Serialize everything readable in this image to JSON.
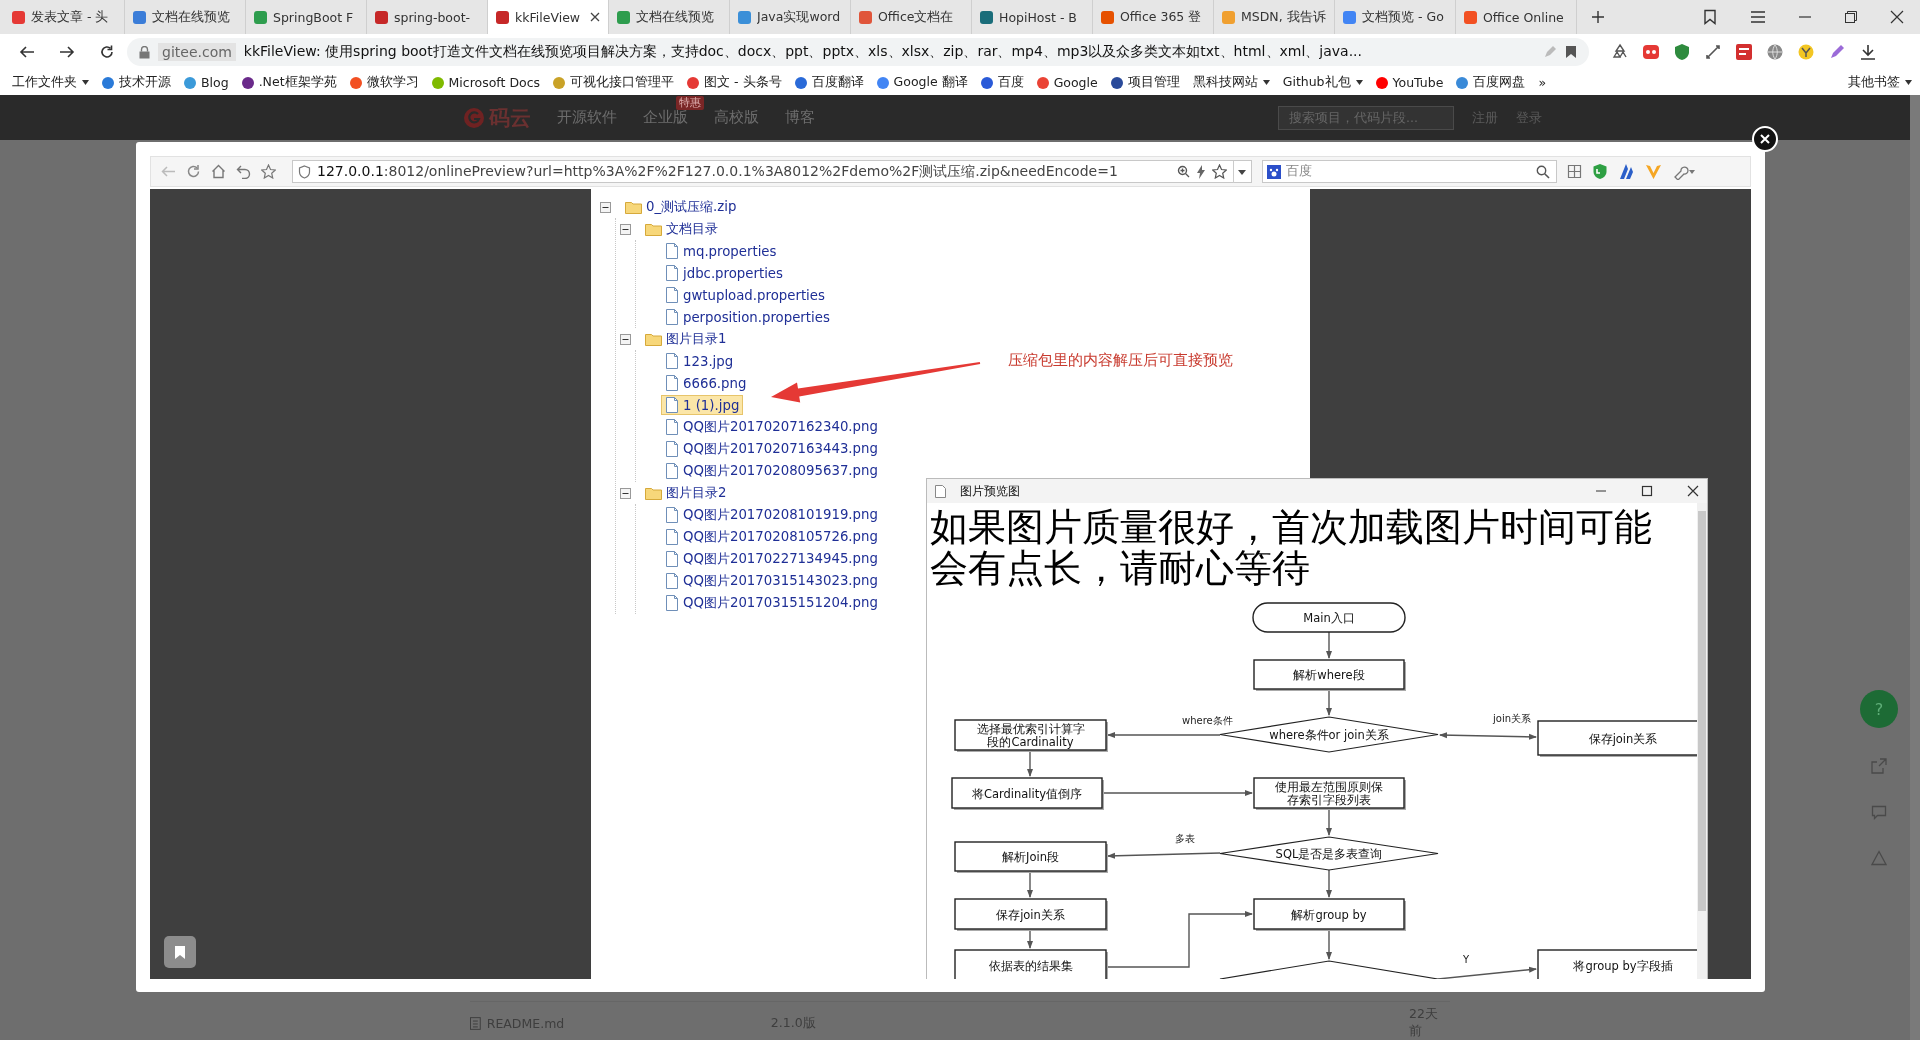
{
  "browser": {
    "tabs": [
      {
        "title": "发表文章 - 头",
        "selected": false,
        "color": "#e53935"
      },
      {
        "title": "文档在线预览",
        "selected": false,
        "color": "#3b7dd8"
      },
      {
        "title": "SpringBoot F",
        "selected": false,
        "color": "#2e9d4e"
      },
      {
        "title": "spring-boot-",
        "selected": false,
        "color": "#c62828"
      },
      {
        "title": "kkFileView",
        "selected": true,
        "color": "#c62828"
      },
      {
        "title": "文档在线预览",
        "selected": false,
        "color": "#2e9d4e"
      },
      {
        "title": "Java实现word",
        "selected": false,
        "color": "#3b8fd8"
      },
      {
        "title": "Office文档在",
        "selected": false,
        "color": "#e0553a"
      },
      {
        "title": "HopiHost - B",
        "selected": false,
        "color": "#1a6d7a"
      },
      {
        "title": "Office 365 登",
        "selected": false,
        "color": "#e65100"
      },
      {
        "title": "MSDN, 我告诉",
        "selected": false,
        "color": "#f0a030"
      },
      {
        "title": "文档预览 - Go",
        "selected": false,
        "color": "#4285f4"
      },
      {
        "title": "Office Online",
        "selected": false,
        "color": "#f25022"
      }
    ],
    "address": {
      "domain": "gitee.com",
      "title": "kkFileView: 使用spring boot打造文件文档在线预览项目解决方案，支持doc、docx、ppt、pptx、xls、xlsx、zip、rar、mp4、mp3以及众多类文本如txt、html、xml、java..."
    },
    "bookmarks": [
      {
        "label": "工作文件夹",
        "dropdown": true
      },
      {
        "label": "技术开源",
        "color": "#2a7ad8",
        "dropdown": false
      },
      {
        "label": "Blog",
        "color": "#3b9ad9",
        "dropdown": false
      },
      {
        "label": ".Net框架学苑",
        "color": "#6a2a8a",
        "dropdown": false
      },
      {
        "label": "微软学习",
        "color": "#f25022",
        "dropdown": false
      },
      {
        "label": "Microsoft Docs",
        "color": "#7fba00",
        "dropdown": false
      },
      {
        "label": "可视化接口管理平",
        "color": "#c9a227",
        "dropdown": false
      },
      {
        "label": "图文 - 头条号",
        "color": "#e53935",
        "dropdown": false
      },
      {
        "label": "百度翻译",
        "color": "#2a6ad8",
        "dropdown": false
      },
      {
        "label": "Google 翻译",
        "color": "#4285f4",
        "dropdown": false
      },
      {
        "label": "百度",
        "color": "#2a5ad8",
        "dropdown": false
      },
      {
        "label": "Google",
        "color": "#ea4335",
        "dropdown": false
      },
      {
        "label": "项目管理",
        "color": "#2a4a9a",
        "dropdown": false
      },
      {
        "label": "黑科技网站",
        "dropdown": true
      },
      {
        "label": "Github礼包",
        "dropdown": true
      },
      {
        "label": "YouTube",
        "color": "#ff0000",
        "dropdown": false
      },
      {
        "label": "百度网盘",
        "color": "#3a8ad8",
        "dropdown": false
      }
    ],
    "overflow": "»",
    "other_bookmarks": "其他书签"
  },
  "site": {
    "logo": "码云",
    "nav": [
      {
        "label": "开源软件"
      },
      {
        "label": "企业版",
        "badge": "特惠"
      },
      {
        "label": "高校版"
      },
      {
        "label": "博客"
      }
    ],
    "search_placeholder": "搜索项目，代码片段...",
    "links": [
      "注册",
      "登录"
    ]
  },
  "viewer": {
    "url_host": "127.0.0.1",
    "url_rest": ":8012/onlinePreview?url=http%3A%2F%2F127.0.0.1%3A8012%2Fdemo%2F测试压缩.zip&needEncode=1",
    "search_placeholder": "百度",
    "tree": [
      {
        "name": "0_测试压缩.zip",
        "kind": "folder",
        "expanded": true,
        "selected": false,
        "children": [
          {
            "name": "文档目录",
            "kind": "folder",
            "expanded": true,
            "selected": false,
            "children": [
              {
                "name": "mq.properties",
                "kind": "file",
                "selected": false
              },
              {
                "name": "jdbc.properties",
                "kind": "file",
                "selected": false
              },
              {
                "name": "gwtupload.properties",
                "kind": "file",
                "selected": false
              },
              {
                "name": "perposition.properties",
                "kind": "file",
                "selected": false
              }
            ]
          },
          {
            "name": "图片目录1",
            "kind": "folder",
            "expanded": true,
            "selected": false,
            "children": [
              {
                "name": "123.jpg",
                "kind": "file",
                "selected": false
              },
              {
                "name": "6666.png",
                "kind": "file",
                "selected": false
              },
              {
                "name": "1 (1).jpg",
                "kind": "file",
                "selected": true
              },
              {
                "name": "QQ图片20170207162340.png",
                "kind": "file",
                "selected": false
              },
              {
                "name": "QQ图片20170207163443.png",
                "kind": "file",
                "selected": false
              },
              {
                "name": "QQ图片20170208095637.png",
                "kind": "file",
                "selected": false
              }
            ]
          },
          {
            "name": "图片目录2",
            "kind": "folder",
            "expanded": true,
            "selected": false,
            "children": [
              {
                "name": "QQ图片20170208101919.png",
                "kind": "file",
                "selected": false
              },
              {
                "name": "QQ图片20170208105726.png",
                "kind": "file",
                "selected": false
              },
              {
                "name": "QQ图片20170227134945.png",
                "kind": "file",
                "selected": false
              },
              {
                "name": "QQ图片20170315143023.png",
                "kind": "file",
                "selected": false
              },
              {
                "name": "QQ图片20170315151204.png",
                "kind": "file",
                "selected": false
              }
            ]
          }
        ]
      }
    ],
    "annotation": "压缩包里的内容解压后可直接预览",
    "preview": {
      "title": "图片预览图",
      "heading": "如果图片质量很好，首次加载图片时间可能会有点长，请耐心等待",
      "nodes": [
        {
          "kind": "terminal",
          "lines": [
            "Main入口"
          ]
        },
        {
          "kind": "process",
          "lines": [
            "解析where段"
          ]
        },
        {
          "kind": "process",
          "lines": [
            "选择最优索引计算字",
            "段的Cardinality"
          ]
        },
        {
          "kind": "decision",
          "lines": [
            "where条件or join关系"
          ]
        },
        {
          "kind": "process",
          "lines": [
            "保存join关系"
          ]
        },
        {
          "kind": "process",
          "lines": [
            "将Cardinality值倒序"
          ]
        },
        {
          "kind": "process",
          "lines": [
            "使用最左范围原则保",
            "存索引字段列表"
          ]
        },
        {
          "kind": "process",
          "lines": [
            "解析Join段"
          ]
        },
        {
          "kind": "decision",
          "lines": [
            "SQL是否是多表查询"
          ]
        },
        {
          "kind": "process",
          "lines": [
            "保存join关系"
          ]
        },
        {
          "kind": "process",
          "lines": [
            "解析group by"
          ]
        },
        {
          "kind": "process",
          "lines": [
            "依据表的结果集"
          ]
        },
        {
          "kind": "decision"
        },
        {
          "kind": "process",
          "lines": [
            "将group by字段插"
          ]
        }
      ],
      "edge_labels": [
        "where条件",
        "join关系",
        "多表",
        "Y"
      ]
    }
  },
  "page": {
    "help": "?",
    "file": {
      "name": "README.md",
      "version": "2.1.0版",
      "time": "22天前"
    }
  }
}
